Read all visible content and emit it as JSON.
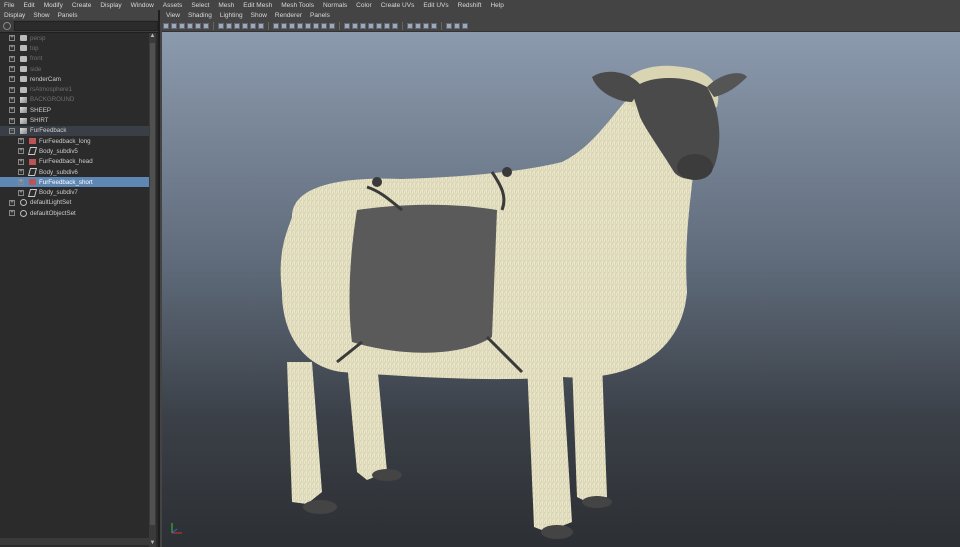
{
  "main_menu": [
    "File",
    "Edit",
    "Modify",
    "Create",
    "Display",
    "Window",
    "Assets",
    "Select",
    "Mesh",
    "Edit Mesh",
    "Mesh Tools",
    "Normals",
    "Color",
    "Create UVs",
    "Edit UVs",
    "Redshift",
    "Help"
  ],
  "outliner": {
    "menu": [
      "Display",
      "Show",
      "Panels"
    ],
    "items": [
      {
        "label": "persp",
        "dim": true,
        "icon": "camera-icon",
        "child": false
      },
      {
        "label": "top",
        "dim": true,
        "icon": "camera-icon",
        "child": false
      },
      {
        "label": "front",
        "dim": true,
        "icon": "camera-icon",
        "child": false
      },
      {
        "label": "side",
        "dim": true,
        "icon": "camera-icon",
        "child": false
      },
      {
        "label": "renderCam",
        "dim": false,
        "icon": "camera-icon",
        "child": false
      },
      {
        "label": "rsAtmosphere1",
        "dim": true,
        "icon": "camera-icon",
        "child": false
      },
      {
        "label": "BACKGROUND",
        "dim": true,
        "icon": "mesh-icon",
        "child": false
      },
      {
        "label": "SHEEP",
        "dim": false,
        "icon": "mesh-icon",
        "child": false
      },
      {
        "label": "SHIRT",
        "dim": false,
        "icon": "mesh-icon",
        "child": false
      },
      {
        "label": "FurFeedback",
        "dim": false,
        "icon": "mesh-icon",
        "child": false,
        "expanded": true,
        "highlight": true
      },
      {
        "label": "FurFeedback_long",
        "dim": false,
        "icon": "fur-icon",
        "child": true
      },
      {
        "label": "Body_subdiv5",
        "dim": false,
        "icon": "poly-icon",
        "child": true
      },
      {
        "label": "FurFeedback_head",
        "dim": false,
        "icon": "fur-icon",
        "child": true
      },
      {
        "label": "Body_subdiv6",
        "dim": false,
        "icon": "poly-icon",
        "child": true
      },
      {
        "label": "FurFeedback_short",
        "dim": false,
        "icon": "fur-icon",
        "child": true,
        "selected": true
      },
      {
        "label": "Body_subdiv7",
        "dim": false,
        "icon": "poly-icon",
        "child": true
      },
      {
        "label": "defaultLightSet",
        "dim": false,
        "icon": "set-icon",
        "child": false
      },
      {
        "label": "defaultObjectSet",
        "dim": false,
        "icon": "set-icon",
        "child": false
      }
    ]
  },
  "viewport": {
    "menu": [
      "View",
      "Shading",
      "Lighting",
      "Show",
      "Renderer",
      "Panels"
    ]
  },
  "colors": {
    "selection": "#5f87b4",
    "wool": "#e7e3c4",
    "skin": "#4a4a4a",
    "background_top": "#8c9aae",
    "background_bottom": "#2c2f33"
  }
}
